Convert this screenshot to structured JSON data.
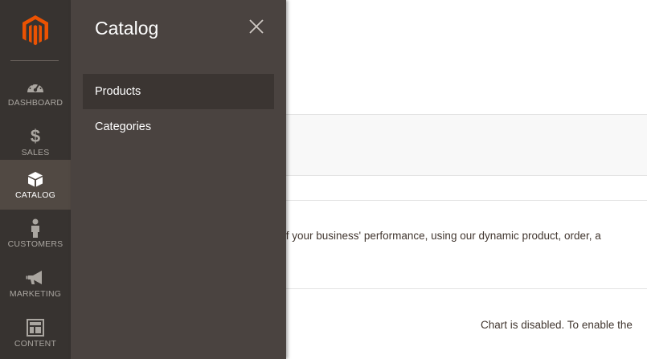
{
  "sidebar": {
    "logo": "magento-logo",
    "accent_color": "#eb5202",
    "items": [
      {
        "label": "DASHBOARD",
        "icon": "dashboard-gauge-icon"
      },
      {
        "label": "SALES",
        "icon": "dollar-icon"
      },
      {
        "label": "CATALOG",
        "icon": "box-icon",
        "active": true
      },
      {
        "label": "CUSTOMERS",
        "icon": "person-icon"
      },
      {
        "label": "MARKETING",
        "icon": "megaphone-icon"
      },
      {
        "label": "CONTENT",
        "icon": "layout-icon"
      }
    ]
  },
  "flyout": {
    "title": "Catalog",
    "close_icon": "close-icon",
    "items": [
      {
        "label": "Products",
        "hovered": true
      },
      {
        "label": "Categories"
      }
    ]
  },
  "content": {
    "description_fragment": "d of your business' performance, using our dynamic product, order, a",
    "chart_message": "Chart is disabled. To enable the"
  }
}
